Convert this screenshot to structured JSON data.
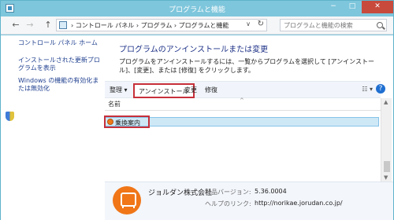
{
  "window": {
    "title": "プログラムと機能",
    "min_label": "−",
    "max_label": "□",
    "close_label": "✕"
  },
  "nav": {
    "back": "←",
    "forward": "→",
    "up": "↑"
  },
  "address": {
    "breadcrumb": "›  コントロール パネル  ›  プログラム  ›  プログラムと機能",
    "dropdown": "∨",
    "refresh": "↻"
  },
  "search": {
    "placeholder": "プログラムと機能の検索"
  },
  "sidebar": {
    "items": [
      {
        "label": "コントロール パネル ホーム"
      },
      {
        "label": "インストールされた更新プログラムを表示"
      },
      {
        "label": "Windows の機能の有効化または無効化"
      }
    ]
  },
  "main": {
    "heading": "プログラムのアンインストールまたは変更",
    "description": "プログラムをアンインストールするには、一覧からプログラムを選択して [アンインストール]、[変更]、または [修復] をクリックします。"
  },
  "toolbar": {
    "organize": "整理",
    "organize_arrow": "▾",
    "uninstall": "アンインストール",
    "change": "変更",
    "repair": "修復",
    "view_icons": "☷  ▾",
    "help": "?"
  },
  "list": {
    "column_name": "名前",
    "sort_arrow": "^",
    "rows": [
      {
        "name": "乗換案内"
      }
    ]
  },
  "scrollbar": {
    "up": "▲",
    "down": "▼"
  },
  "details": {
    "publisher": "ジョルダン株式会社",
    "version_label": "製品バージョン:",
    "version": "5.36.0004",
    "help_label": "ヘルプのリンク:",
    "help_link": "http://norikae.jorudan.co.jp/"
  }
}
